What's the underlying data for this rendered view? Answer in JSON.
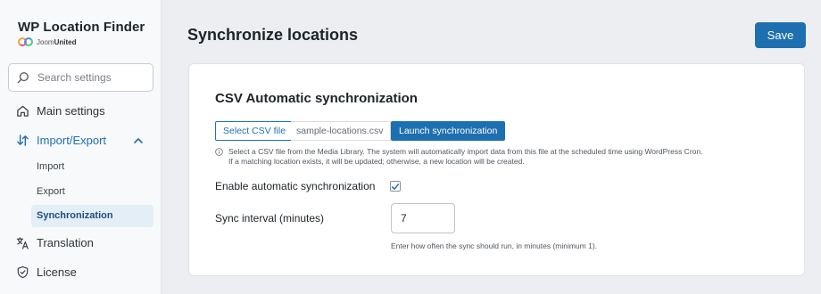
{
  "brand": {
    "title": "WP Location Finder",
    "sub_prefix": "Joom",
    "sub_bold": "United"
  },
  "search": {
    "placeholder": "Search settings"
  },
  "nav": {
    "main_settings": "Main settings",
    "import_export": "Import/Export",
    "sub_items": {
      "import": "Import",
      "export": "Export",
      "synchronization": "Synchronization"
    },
    "translation": "Translation",
    "license": "License"
  },
  "header": {
    "title": "Synchronize locations",
    "save_label": "Save"
  },
  "card": {
    "title": "CSV Automatic synchronization",
    "select_file_label": "Select CSV file",
    "file_name": "sample-locations.csv",
    "launch_label": "Launch synchronization",
    "help_line1": "Select a CSV file from the Media Library. The system will automatically import data from this file at the scheduled time using WordPress Cron.",
    "help_line2": "If a matching location exists, it will be updated; otherwise, a new location will be created.",
    "enable_label": "Enable automatic synchronization",
    "enable_checked": true,
    "interval_label": "Sync interval (minutes)",
    "interval_value": "7",
    "interval_help": "Enter how often the sync should run, in minutes (minimum 1)."
  },
  "colors": {
    "accent": "#1e6fb0",
    "active_bg": "#e4eef7"
  }
}
